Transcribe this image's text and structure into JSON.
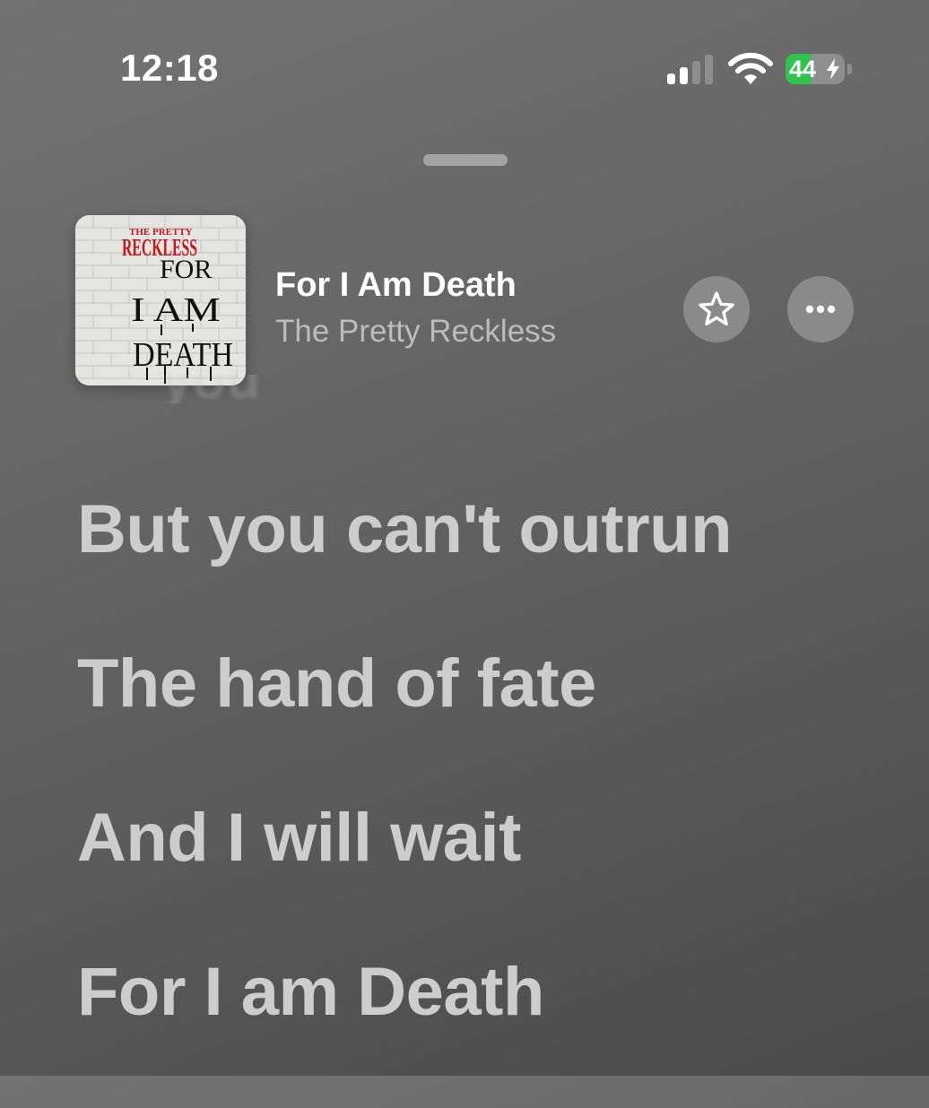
{
  "status_bar": {
    "time": "12:18",
    "battery_level": "44",
    "battery_percent": 44,
    "battery_charging": true,
    "signal_bars_active": 2,
    "signal_bars_total": 4,
    "icons": [
      "cellular-signal-icon",
      "wifi-icon",
      "battery-icon",
      "charging-bolt-icon"
    ]
  },
  "now_playing": {
    "title": "For I Am Death",
    "artist": "The Pretty Reckless",
    "artwork": {
      "band_text": "THE PRETTY",
      "band_text_2": "RECKLESS",
      "title_line_1": "FOR",
      "title_line_2": "I AM",
      "title_line_3": "DEATH"
    },
    "buttons": [
      "star-icon",
      "ellipsis-icon"
    ]
  },
  "lyrics": {
    "previous_line_ghost": "you",
    "lines": [
      "But you can't outrun",
      "The hand of fate",
      "And I will wait",
      "For I am Death"
    ]
  },
  "colors": {
    "background": "#666666",
    "lyric_text": "#cdcdcd",
    "title_text": "#ffffff",
    "artist_text": "#bcbcbc",
    "battery_green": "#32c24d",
    "artwork_red": "#c41a1a",
    "artwork_black": "#111111"
  }
}
